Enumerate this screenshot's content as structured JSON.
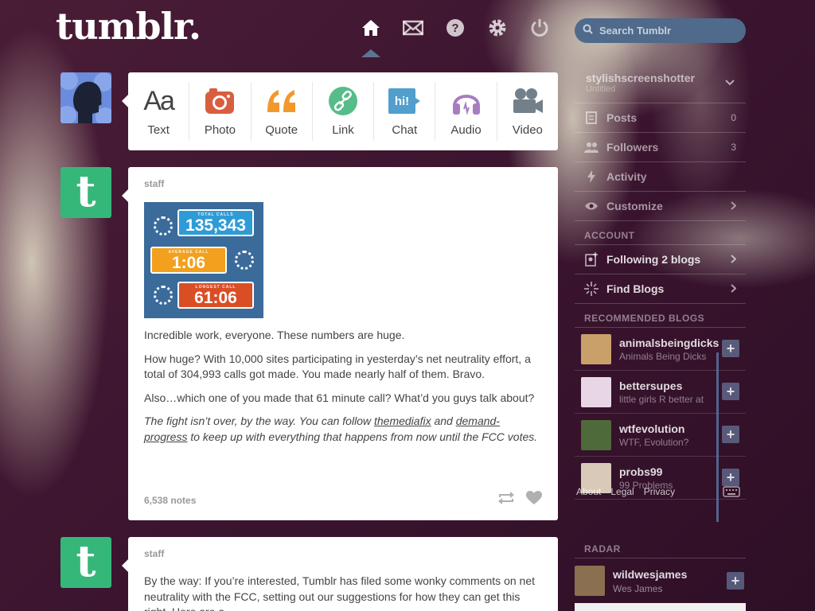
{
  "app": {
    "logo": "tumblr."
  },
  "search": {
    "placeholder": "Search Tumblr"
  },
  "post_types": [
    {
      "label": "Text",
      "icon": "text-icon",
      "color": "#444444"
    },
    {
      "label": "Photo",
      "icon": "camera-icon",
      "color": "#d95e40"
    },
    {
      "label": "Quote",
      "icon": "quote-icon",
      "color": "#f2992e"
    },
    {
      "label": "Link",
      "icon": "link-icon",
      "color": "#56bc8a"
    },
    {
      "label": "Chat",
      "icon": "chat-icon",
      "color": "#529ecc"
    },
    {
      "label": "Audio",
      "icon": "headphones-icon",
      "color": "#a77dc2"
    },
    {
      "label": "Video",
      "icon": "video-camera-icon",
      "color": "#748089"
    }
  ],
  "post1": {
    "author": "staff",
    "image": {
      "total_calls_label": "TOTAL CALLS",
      "total_calls": "135,343",
      "average_call_label": "AVERAGE CALL",
      "average_call": "1:06",
      "longest_call_label": "LONGEST CALL",
      "longest_call": "61:06"
    },
    "p1": "Incredible work, everyone. These numbers are huge.",
    "p2": "How huge? With 10,000 sites participating in yesterday’s net neutrality effort, a total of 304,993 calls got made. You made nearly half of them. Bravo.",
    "p3": "Also…which one of you made that 61 minute call? What’d you guys talk about?",
    "p4_a": "The fight isn’t over, by the way. You can follow ",
    "p4_link1": "themediafix",
    "p4_b": " and ",
    "p4_link2": "demand-progress",
    "p4_c": " to keep up with everything that happens from now until the FCC votes.",
    "notes": "6,538 notes"
  },
  "post2": {
    "author": "staff",
    "p1": "By the way: If you’re interested, Tumblr has filed some wonky comments on net neutrality with the FCC, setting out our suggestions for how they can get this right. Here are a"
  },
  "sidebar": {
    "blog_name": "stylishscreenshotter",
    "blog_title": "Untitled",
    "posts_label": "Posts",
    "posts_count": "0",
    "followers_label": "Followers",
    "followers_count": "3",
    "activity_label": "Activity",
    "customize_label": "Customize",
    "account_label": "ACCOUNT",
    "following_label": "Following 2 blogs",
    "find_blogs_label": "Find Blogs",
    "recommended_label": "RECOMMENDED BLOGS",
    "recommended": [
      {
        "name": "animalsbeingdicks",
        "title": "Animals Being Dicks",
        "color": "#c9a06a"
      },
      {
        "name": "bettersupes",
        "title": "little girls R better at",
        "color": "#e8d6e4"
      },
      {
        "name": "wtfevolution",
        "title": "WTF, Evolution?",
        "color": "#4f6a3a"
      },
      {
        "name": "probs99",
        "title": "99 Problems",
        "color": "#d8c9b8"
      }
    ],
    "footer_about": "About",
    "footer_legal": "Legal",
    "footer_privacy": "Privacy",
    "radar_label": "RADAR",
    "radar_name": "wildwesjames",
    "radar_title": "Wes James"
  }
}
